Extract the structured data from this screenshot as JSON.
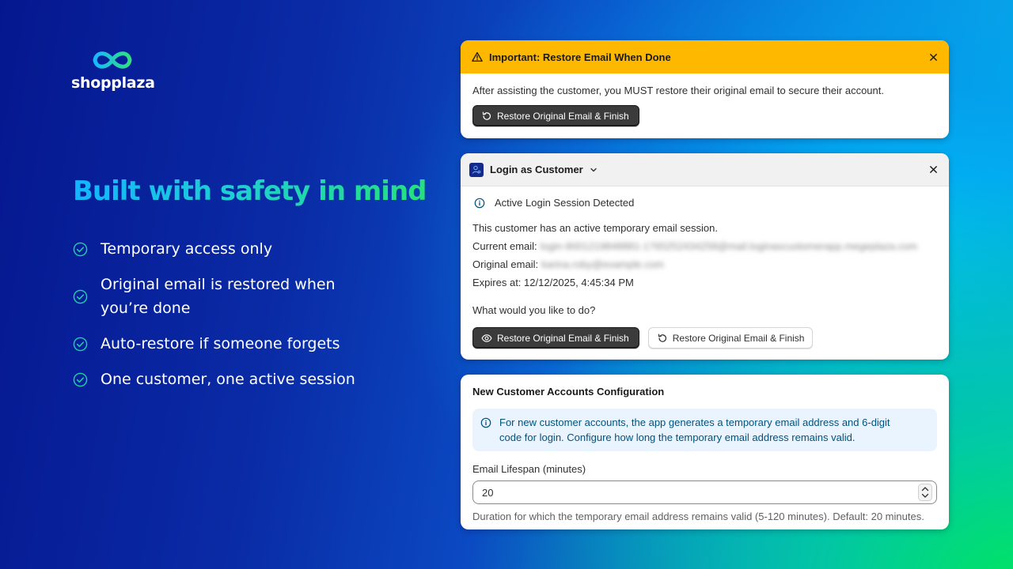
{
  "brand": {
    "name": "shopplaza"
  },
  "headline": "Built with safety in mind",
  "features": [
    {
      "text": "Temporary access only"
    },
    {
      "text": "Original email is restored when you’re done"
    },
    {
      "text": "Auto-restore if someone forgets"
    },
    {
      "text": "One customer, one active session"
    }
  ],
  "alert_card": {
    "title": "Important: Restore Email When Done",
    "message": "After assisting the customer, you MUST restore their original email to secure their account.",
    "button_label": "Restore Original Email & Finish"
  },
  "login_card": {
    "title": "Login as Customer",
    "notice": "Active Login Session Detected",
    "status": "This customer has an active temporary email session.",
    "current_email_label": "Current email:",
    "current_email_value": "login-9001219848881-1765252434258@mail.loginascustomerapp.megeplaza.com",
    "original_email_label": "Original email:",
    "original_email_value": "karina.roby@example.com",
    "expires_label": "Expires at:",
    "expires_value": "12/12/2025, 4:45:34 PM",
    "question": "What would you like to do?",
    "primary_button": "Restore Original Email & Finish",
    "secondary_button": "Restore Original Email & Finish"
  },
  "config_card": {
    "title": "New Customer Accounts Configuration",
    "info_line1": "For new customer accounts, the app generates a temporary email address and 6-digit",
    "info_line2": "code for login. Configure how long the temporary email address remains valid.",
    "field_label": "Email Lifespan (minutes)",
    "field_value": "20",
    "help_text": "Duration for which the temporary email address remains valid (5-120 minutes). Default: 20 minutes."
  },
  "colors": {
    "alert_header": "#ffb800",
    "dark_button": "#3b3b3b",
    "info_banner_bg": "#eaf4ff",
    "info_banner_text": "#00527c"
  }
}
